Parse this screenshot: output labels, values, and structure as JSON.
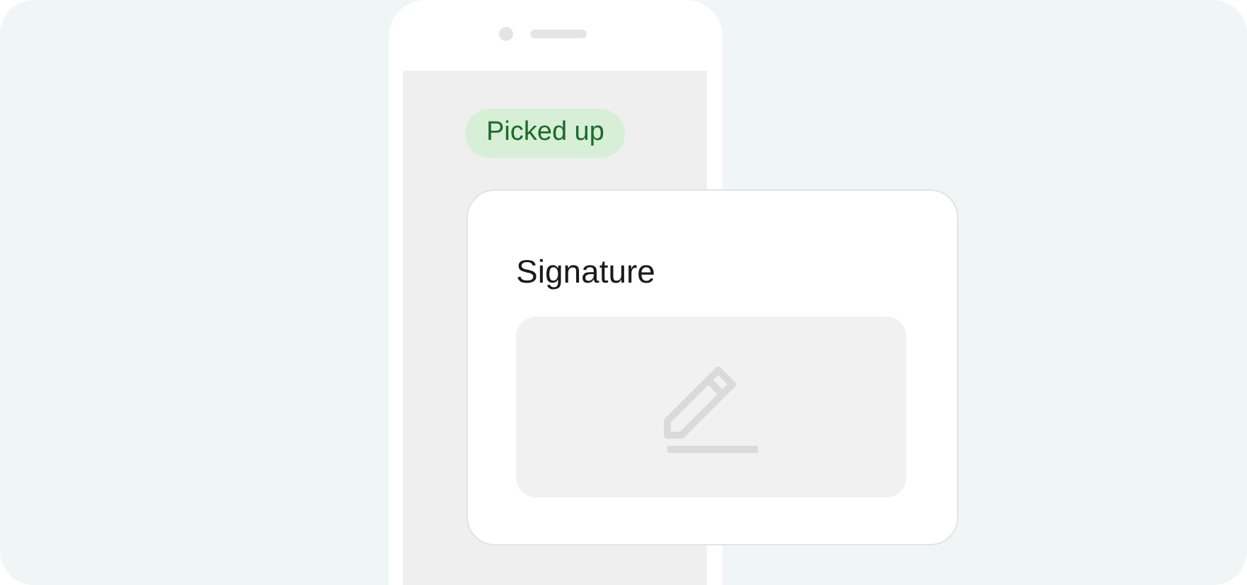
{
  "status_badge": {
    "label": "Picked up"
  },
  "signature_card": {
    "title": "Signature"
  }
}
